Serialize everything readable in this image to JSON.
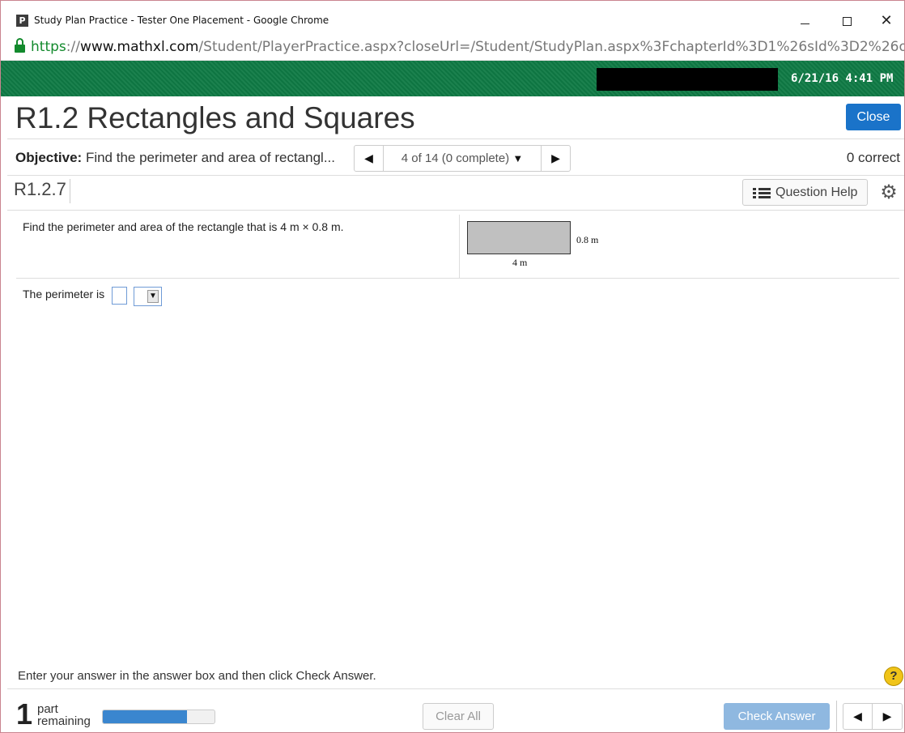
{
  "browser": {
    "favicon_letter": "P",
    "window_title": "Study Plan Practice - Tester One Placement - Google Chrome",
    "url_scheme": "https",
    "url_sep": "://",
    "url_host": "www.mathxl.com",
    "url_path": "/Student/PlayerPractice.aspx?closeUrl=/Student/StudyPlan.aspx%3FchapterId%3D1%26sId%3D2%26objectiveId%",
    "minimize_icon": "minimize-icon",
    "maximize_icon": "maximize-icon",
    "close_glyph": "✕"
  },
  "banner": {
    "datetime": "6/21/16 4:41 PM",
    "color": "#0f7a45"
  },
  "header": {
    "title": "R1.2 Rectangles and Squares",
    "close_label": "Close"
  },
  "objective": {
    "label": "Objective:",
    "text": "Find the perimeter and area of rectangl...",
    "prev_glyph": "◀",
    "next_glyph": "▶",
    "status": "4 of 14 (0 complete)",
    "status_caret": "▼",
    "correct": "0 correct"
  },
  "question": {
    "id": "R1.2.7",
    "help_label": "Question Help",
    "gear_glyph": "⚙",
    "prompt": "Find the perimeter and area of the rectangle that is 4 m × 0.8 m.",
    "figure_height_label": "0.8 m",
    "figure_width_label": "4 m",
    "answer_prefix": "The perimeter is",
    "answer_value": "",
    "unit_selected": "",
    "select_arrow": "▼"
  },
  "footer": {
    "instruction": "Enter your answer in the answer box and then click Check Answer.",
    "help_glyph": "?",
    "parts_count": "1",
    "parts_line1": "part",
    "parts_line2": "remaining",
    "progress_fraction": 0.75,
    "clear_label": "Clear All",
    "check_label": "Check Answer",
    "prev_glyph": "◀",
    "next_glyph": "▶"
  },
  "colors": {
    "accent": "#1a73c9",
    "check_disabled": "#8fb8e0",
    "progress": "#3a86cf",
    "secure": "#138a2d"
  }
}
